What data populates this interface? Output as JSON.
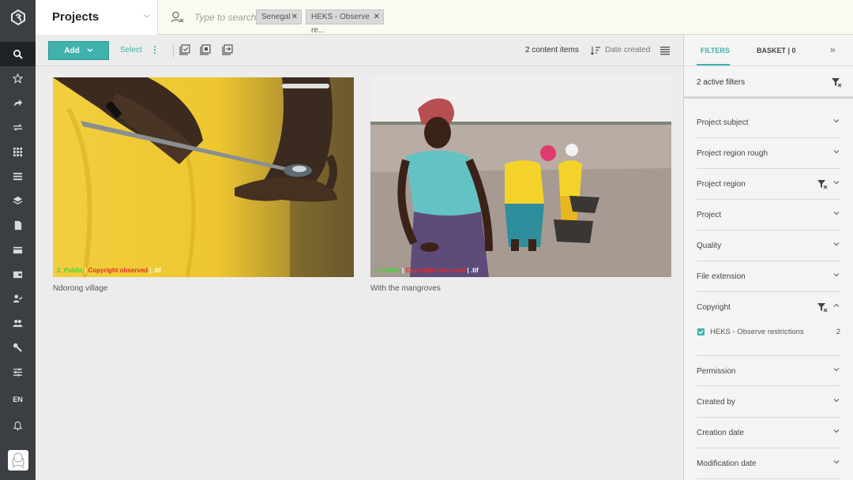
{
  "rail": {
    "lang": "EN",
    "items": [
      {
        "name": "search",
        "active": true
      },
      {
        "name": "star"
      },
      {
        "name": "share"
      },
      {
        "name": "transfer"
      },
      {
        "name": "grid"
      },
      {
        "name": "list"
      },
      {
        "name": "layers"
      },
      {
        "name": "document"
      },
      {
        "name": "id-card"
      },
      {
        "name": "wallet"
      },
      {
        "name": "user-check"
      },
      {
        "name": "users"
      },
      {
        "name": "wrench"
      },
      {
        "name": "sliders"
      }
    ]
  },
  "header": {
    "channel": "Projects",
    "search_placeholder": "Type to search",
    "chips": [
      "Senegal",
      "HEKS - Observe re..."
    ]
  },
  "toolbar": {
    "add_label": "Add",
    "select_label": "Select",
    "count": "2 content items",
    "sort_label": "Date created"
  },
  "cards": [
    {
      "caption": "Ndorong village",
      "overlay_green": "2. Public",
      "overlay_sep": " | ",
      "overlay_red": "Copyright observed",
      "overlay_ext": " | .tif"
    },
    {
      "caption": "With the mangroves",
      "overlay_green": "2. Public",
      "overlay_sep": " | ",
      "overlay_red": "Copyright observed",
      "overlay_ext": " | .tif"
    }
  ],
  "panel": {
    "tab_filters": "FILTERS",
    "tab_basket": "BASKET | 0",
    "active_filters": "2 active filters",
    "filters": [
      {
        "label": "Project subject"
      },
      {
        "label": "Project region rough"
      },
      {
        "label": "Project region",
        "clear": true
      },
      {
        "label": "Project"
      },
      {
        "label": "Quality"
      },
      {
        "label": "File extension"
      },
      {
        "label": "Copyright",
        "clear": true,
        "expanded": true
      },
      {
        "label": "Permission"
      },
      {
        "label": "Created by"
      },
      {
        "label": "Creation date"
      },
      {
        "label": "Modification date"
      }
    ],
    "copyright_option": {
      "label": "HEKS - Observe restrictions",
      "count": "2",
      "checked": true
    }
  },
  "colors": {
    "accent": "#3fb2ad",
    "rail": "#3b3f43",
    "topbar": "#fafaf0"
  }
}
